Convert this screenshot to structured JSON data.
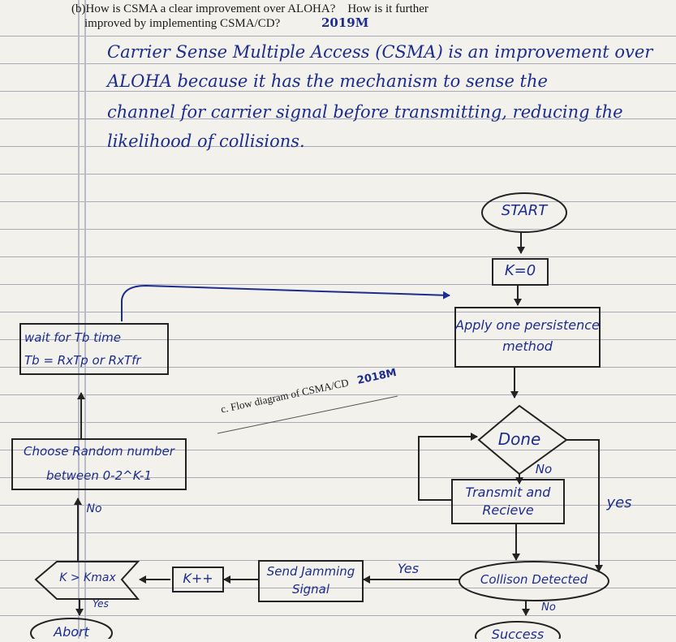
{
  "question": {
    "line1": "(b)How is CSMA a clear improvement over ALOHA?    How is it further",
    "line2": "improved by implementing CSMA/CD?",
    "year_tag": "2019M"
  },
  "answer_lines": [
    "Carrier Sense Multiple Access (CSMA) is an improvement over",
    "ALOHA because it has the mechanism to sense the",
    "channel for carrier signal before transmitting, reducing the",
    "likelihood of collisions."
  ],
  "caption": {
    "text": "c. Flow diagram of CSMA/CD",
    "year_tag": "2018M"
  },
  "flow": {
    "start": "START",
    "k_init": "K=0",
    "persistence": [
      "Apply one persistence",
      "method"
    ],
    "done": "Done",
    "done_no": "No",
    "transmit": [
      "Transmit and",
      "Recieve"
    ],
    "yes_right": "yes",
    "collision": "Collison Detected",
    "collision_yes": "Yes",
    "collision_no": "No",
    "success": "Success",
    "jamming": [
      "Send Jamming",
      "Signal"
    ],
    "k_inc": "K++",
    "kmax": "K > Kmax",
    "kmax_yes": "Yes",
    "abort": "Abort",
    "random": [
      "Choose Random number",
      "between 0-2^K-1"
    ],
    "random_no": "No",
    "wait": [
      "wait for Tb time",
      "Tb = RxTp or RxTfr"
    ]
  }
}
